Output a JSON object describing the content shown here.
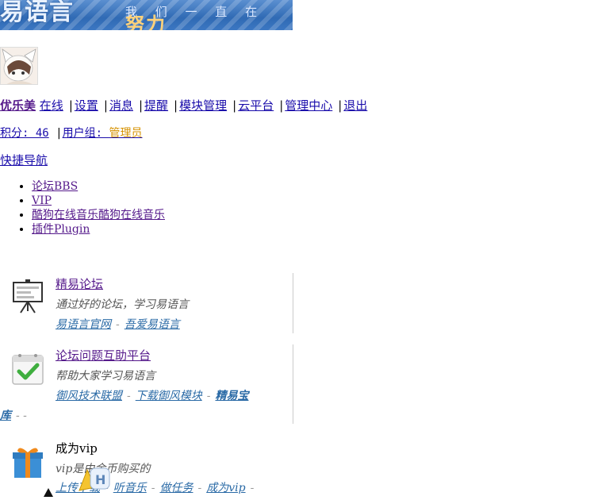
{
  "banner": {
    "logo_text": "易语言",
    "slogan": "我 们 一 直 在",
    "slogan_bold": "努力"
  },
  "user_bar": {
    "username": "优乐美",
    "online": "在线",
    "items": [
      "设置",
      "消息",
      "提醒",
      "模块管理",
      "云平台",
      "管理中心",
      "退出"
    ]
  },
  "points": {
    "label": "积分: 46",
    "group_label": "用户组: ",
    "group_value": "管理员"
  },
  "quick_nav": {
    "title": "快捷导航",
    "items": [
      "论坛BBS",
      "VIP",
      "酷狗在线音乐酷狗在线音乐",
      "插件Plugin"
    ]
  },
  "features": [
    {
      "title": "精易论坛",
      "desc": "通过好的论坛，学习易语言",
      "links": [
        "易语言官网",
        "吾爱易语言"
      ]
    },
    {
      "title": "论坛问题互助平台",
      "desc": "帮助大家学习易语言",
      "links": [
        "御风技术联盟",
        "下载御风模块",
        "精易宝"
      ],
      "wrap": "库"
    },
    {
      "title": "成为vip",
      "desc": "vip是由金币购买的",
      "links": [
        "上传下载",
        "听音乐",
        "做任务",
        "成为vip"
      ]
    }
  ],
  "icons": {
    "feature_1": "presentation-board-icon",
    "feature_2": "checkmark-calendar-icon",
    "feature_3": "gift-box-icon"
  }
}
